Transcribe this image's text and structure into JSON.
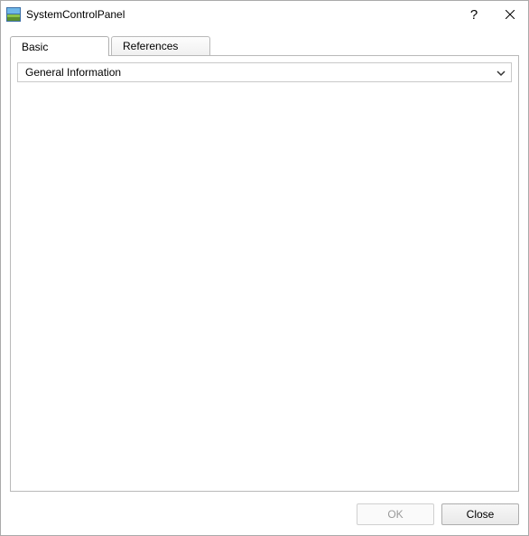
{
  "window": {
    "title": "SystemControlPanel"
  },
  "tabs": {
    "basic": "Basic",
    "references": "References"
  },
  "combo": {
    "selected": "General Information"
  },
  "buttons": {
    "ok": "OK",
    "close": "Close"
  }
}
